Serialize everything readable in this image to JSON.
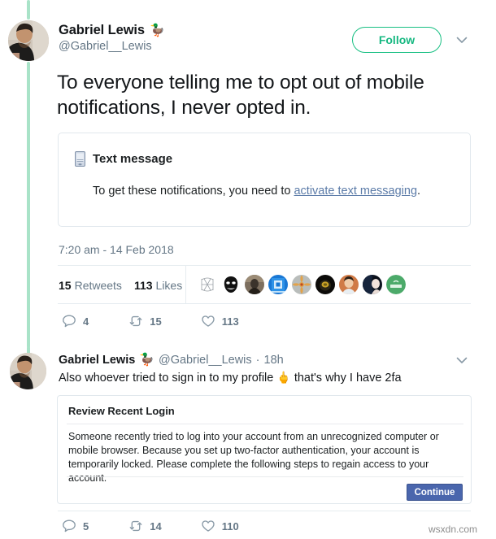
{
  "thread": {
    "main_tweet": {
      "author": {
        "display_name": "Gabriel Lewis",
        "emoji": "🦆",
        "handle": "@Gabriel__Lewis",
        "avatar_name": "gabriel-lewis-avatar"
      },
      "follow_label": "Follow",
      "caret_icon": "chevron-down-icon",
      "text": "To everyone telling me to opt out of mobile notifications, I never opted in.",
      "card": {
        "icon": "mobile-phone-icon",
        "title": "Text message",
        "body_prefix": "To get these notifications, you need to ",
        "link_text": "activate text messaging",
        "body_suffix": "."
      },
      "timestamp": "7:20 am - 14 Feb 2018",
      "stats": {
        "retweets_count": "15",
        "retweets_label": "Retweets",
        "likes_count": "113",
        "likes_label": "Likes"
      },
      "actions": {
        "reply_count": "4",
        "retweet_count": "15",
        "like_count": "113",
        "reply_icon": "comment-bubble-icon",
        "retweet_icon": "retweet-icon",
        "like_icon": "heart-icon"
      }
    },
    "reply_tweet": {
      "author": {
        "display_name": "Gabriel Lewis",
        "emoji": "🦆",
        "handle": "@Gabriel__Lewis",
        "separator": "·",
        "time_ago": "18h",
        "avatar_name": "gabriel-lewis-avatar"
      },
      "caret_icon": "chevron-down-icon",
      "text_before": "Also whoever tried to sign in to my profile",
      "emoji": "🖕",
      "text_after": "that's why I have 2fa",
      "card": {
        "title": "Review Recent Login",
        "body": "Someone recently tried to log into your account from an unrecognized computer or mobile browser. Because you set up two-factor authentication, your account is temporarily locked. Please complete the following steps to regain access to your account.",
        "button_label": "Continue"
      },
      "actions": {
        "reply_count": "5",
        "retweet_count": "14",
        "like_count": "110",
        "reply_icon": "comment-bubble-icon",
        "retweet_icon": "retweet-icon",
        "like_icon": "heart-icon"
      }
    },
    "likers": [
      {
        "name": "liker-avatar-monogram",
        "bg": "#ffffff"
      },
      {
        "name": "liker-avatar-anonymous-mask",
        "bg": "#ffffff"
      },
      {
        "name": "liker-avatar-person-dark",
        "bg": "#6d6156"
      },
      {
        "name": "liker-avatar-blue-pattern",
        "bg": "#1f7fd6"
      },
      {
        "name": "liker-avatar-flower-grey",
        "bg": "#b9bdbb"
      },
      {
        "name": "liker-avatar-black-helmet",
        "bg": "#14120f"
      },
      {
        "name": "liker-avatar-person-orange",
        "bg": "#c9814f"
      },
      {
        "name": "liker-avatar-dark-portrait",
        "bg": "#101726"
      },
      {
        "name": "liker-avatar-green-logo",
        "bg": "#4caa6a"
      }
    ]
  },
  "watermark": "wsxdn.com",
  "colors": {
    "follow_green": "#16b881",
    "thread_line": "#a9e3c8",
    "link_blue": "#5b7ba8",
    "continue_blue": "#4a66ad",
    "muted_text": "#657786",
    "border": "#e1e8ed"
  }
}
